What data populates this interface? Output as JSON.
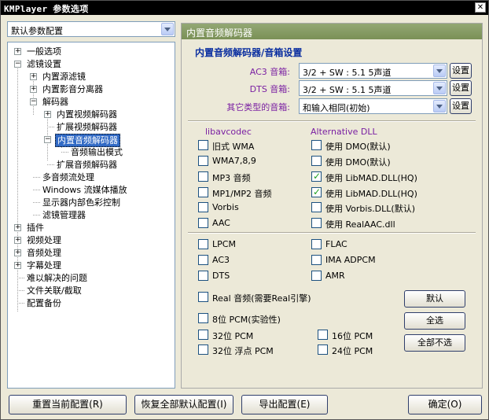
{
  "window": {
    "title": "KMPlayer 参数选项",
    "close_glyph": "✕"
  },
  "preset": {
    "selected": "默认参数配置"
  },
  "tree": {
    "expand_plus": "+",
    "expand_minus": "−",
    "nodes": [
      {
        "label": "一般选项"
      },
      {
        "label": "滤镜设置"
      },
      {
        "label": "内置源滤镜"
      },
      {
        "label": "内置影音分离器"
      },
      {
        "label": "解码器"
      },
      {
        "label": "内置视频解码器"
      },
      {
        "label": "扩展视频解码器"
      },
      {
        "label": "内置音频解码器"
      },
      {
        "label": "音频输出模式"
      },
      {
        "label": "扩展音频解码器"
      },
      {
        "label": "多音频流处理"
      },
      {
        "label": "Windows 流媒体播放"
      },
      {
        "label": "显示器内部色彩控制"
      },
      {
        "label": "滤镜管理器"
      },
      {
        "label": "插件"
      },
      {
        "label": "视频处理"
      },
      {
        "label": "音频处理"
      },
      {
        "label": "字幕处理"
      },
      {
        "label": "难以解决的问题"
      },
      {
        "label": "文件关联/截取"
      },
      {
        "label": "配置备份"
      }
    ]
  },
  "panel": {
    "header": "内置音频解码器",
    "section_title": "内置音频解码器/音箱设置",
    "rows": [
      {
        "label": "AC3 音箱:",
        "value": "3/2 + SW : 5.1 5声道",
        "button": "设置"
      },
      {
        "label": "DTS 音箱:",
        "value": "3/2 + SW : 5.1 5声道",
        "button": "设置"
      },
      {
        "label": "其它类型的音箱:",
        "value": "和输入相同(初始)",
        "button": "设置"
      }
    ],
    "col_left_head": "libavcodec",
    "col_right_head": "Alternative DLL",
    "left_checks": [
      {
        "label": "旧式 WMA",
        "checked": false
      },
      {
        "label": "WMA7,8,9",
        "checked": false
      },
      {
        "label": "MP3 音频",
        "checked": false
      },
      {
        "label": "MP1/MP2 音频",
        "checked": false
      },
      {
        "label": "Vorbis",
        "checked": false
      },
      {
        "label": "AAC",
        "checked": false
      }
    ],
    "right_checks": [
      {
        "label": "使用 DMO(默认)",
        "checked": false
      },
      {
        "label": "使用 DMO(默认)",
        "checked": false
      },
      {
        "label": "使用 LibMAD.DLL(HQ)",
        "checked": true
      },
      {
        "label": "使用 LibMAD.DLL(HQ)",
        "checked": true
      },
      {
        "label": "使用 Vorbis.DLL(默认)",
        "checked": false
      },
      {
        "label": "使用 RealAAC.dll",
        "checked": false
      }
    ],
    "pcm_left": [
      {
        "label": "LPCM",
        "checked": false
      },
      {
        "label": "AC3",
        "checked": false
      },
      {
        "label": "DTS",
        "checked": false
      }
    ],
    "pcm_right": [
      {
        "label": "FLAC",
        "checked": false
      },
      {
        "label": "IMA ADPCM",
        "checked": false
      },
      {
        "label": "AMR",
        "checked": false
      }
    ],
    "real_audio": {
      "label": "Real 音频(需要Real引擎)",
      "checked": false
    },
    "pcm8": {
      "label": "8位 PCM(实验性)",
      "checked": false
    },
    "pcm32": {
      "label": "32位 PCM",
      "checked": false
    },
    "pcm16": {
      "label": "16位 PCM",
      "checked": false
    },
    "pcm32f": {
      "label": "32位 浮点 PCM",
      "checked": false
    },
    "pcm24": {
      "label": "24位 PCM",
      "checked": false
    },
    "btn_default": "默认",
    "btn_select_all": "全选",
    "btn_select_none": "全部不选"
  },
  "footer": {
    "reset": "重置当前配置(R)",
    "restore": "恢复全部默认配置(I)",
    "export": "导出配置(E)",
    "ok": "确定(O)"
  }
}
